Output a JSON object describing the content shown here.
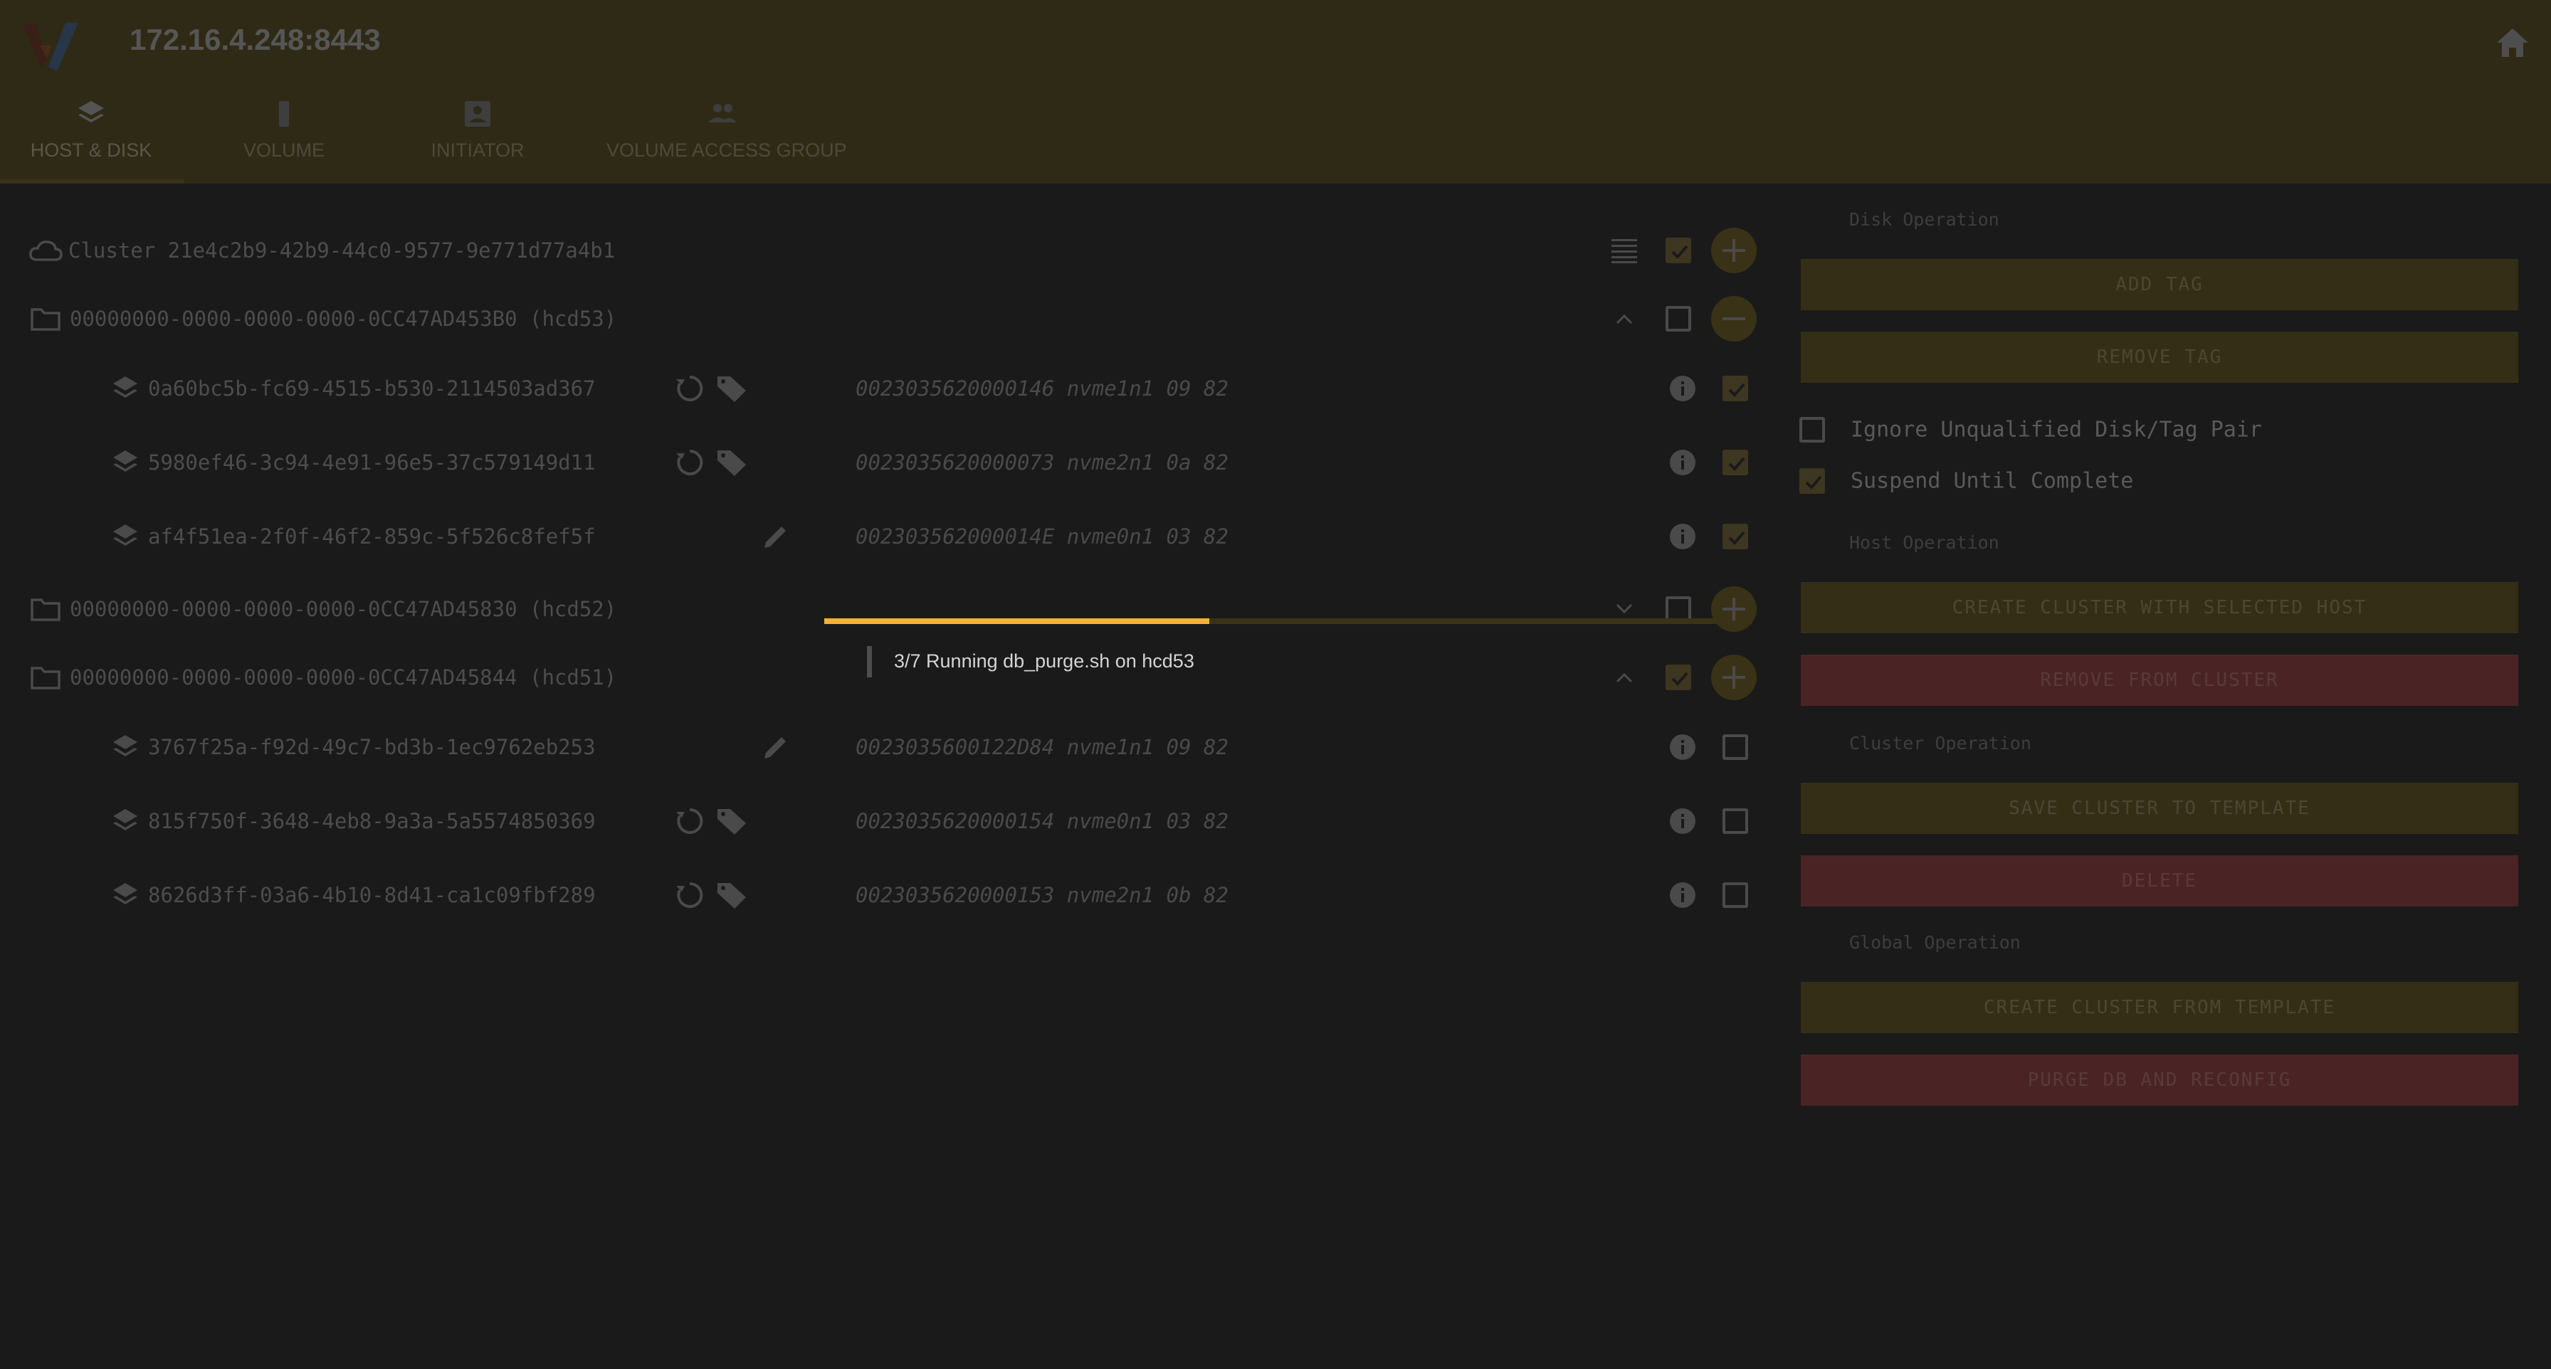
{
  "header": {
    "title": "172.16.4.248:8443",
    "logo_icon": "logo-icon",
    "home_icon": "home-icon"
  },
  "tabs": [
    {
      "label": "HOST & DISK",
      "icon": "layers-icon",
      "active": true
    },
    {
      "label": "VOLUME",
      "icon": "battery-icon",
      "active": false
    },
    {
      "label": "INITIATOR",
      "icon": "badge-icon",
      "active": false
    },
    {
      "label": "VOLUME ACCESS GROUP",
      "icon": "group-icon",
      "active": false
    }
  ],
  "tree": {
    "cluster_label": "Cluster 21e4c2b9-42b9-44c0-9577-9e771d77a4b1",
    "hosts": [
      {
        "label": "00000000-0000-0000-0000-0CC47AD453B0 (hcd53)",
        "expanded": true,
        "checked": false,
        "disks": [
          {
            "id": "0a60bc5b-fc69-4515-b530-2114503ad367",
            "meta": "0023035620000146 nvme1n1 09 82",
            "checked": true,
            "tagged": true
          },
          {
            "id": "5980ef46-3c94-4e91-96e5-37c579149d11",
            "meta": "0023035620000073 nvme2n1 0a 82",
            "checked": true,
            "tagged": true
          },
          {
            "id": "af4f51ea-2f0f-46f2-859c-5f526c8fef5f",
            "meta": "002303562000014E nvme0n1 03 82",
            "checked": true,
            "tagged": false
          }
        ]
      },
      {
        "label": "00000000-0000-0000-0000-0CC47AD45830 (hcd52)",
        "expanded": false,
        "checked": false,
        "disks": []
      },
      {
        "label": "00000000-0000-0000-0000-0CC47AD45844 (hcd51)",
        "expanded": true,
        "checked": true,
        "disks": [
          {
            "id": "3767f25a-f92d-49c7-bd3b-1ec9762eb253",
            "meta": "0023035600122D84 nvme1n1 09 82",
            "checked": false,
            "tagged": false
          },
          {
            "id": "815f750f-3648-4eb8-9a3a-5a5574850369",
            "meta": "0023035620000154 nvme0n1 03 82",
            "checked": false,
            "tagged": true
          },
          {
            "id": "8626d3ff-03a6-4b10-8d41-ca1c09fbf289",
            "meta": "0023035620000153 nvme2n1 0b 82",
            "checked": false,
            "tagged": true
          }
        ]
      }
    ]
  },
  "progress": {
    "text": "3/7 Running db_purge.sh on hcd53",
    "fraction": 0.43,
    "color": "#f2b430"
  },
  "panel": {
    "disk_operation": "Disk Operation",
    "add_tag": "ADD TAG",
    "remove_tag": "REMOVE TAG",
    "ignore_unqualified": "Ignore Unqualified Disk/Tag Pair",
    "suspend_until_complete": "Suspend Until Complete",
    "host_operation": "Host Operation",
    "create_cluster_selected": "CREATE CLUSTER WITH SELECTED HOST",
    "remove_from_cluster": "REMOVE FROM CLUSTER",
    "cluster_operation": "Cluster Operation",
    "save_cluster_template": "SAVE CLUSTER TO TEMPLATE",
    "delete": "DELETE",
    "global_operation": "Global Operation",
    "create_cluster_template": "CREATE CLUSTER FROM TEMPLATE",
    "purge_db": "PURGE DB AND RECONFIG"
  },
  "colors": {
    "accent": "#f2b430",
    "danger": "#4a2424",
    "background": "#1a1a1a"
  }
}
